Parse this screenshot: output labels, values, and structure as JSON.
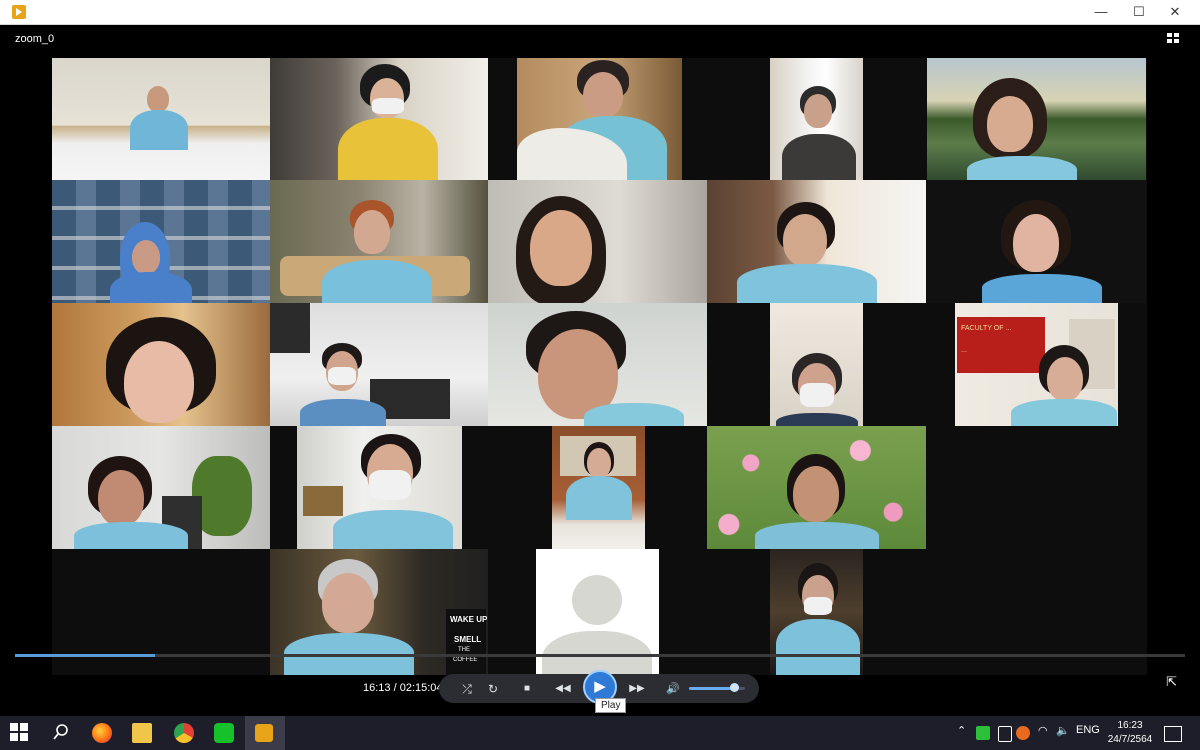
{
  "window": {
    "title": "zoom_0",
    "minimize": "—",
    "maximize": "☐",
    "close": "✕"
  },
  "player": {
    "current_time": "16:13",
    "total_time": "02:15:04",
    "time_separator": " / ",
    "progress": 0.12,
    "volume": 0.8,
    "tooltip": "Play"
  },
  "controls": {
    "shuffle": "⤮",
    "repeat": "↻",
    "stop": "■",
    "prev": "◀◀",
    "play": "▶",
    "next": "▶▶",
    "volume": "🔊"
  },
  "taskbar": {
    "language": "ENG",
    "time": "16:23",
    "date": "24/7/2564"
  },
  "slides": {
    "wake_up": "WAKE UP",
    "smell": "SMELL",
    "the": "THE",
    "coffee": "COFFEE"
  },
  "sign": {
    "line1": "FACULTY OF ...",
    "line2": "..."
  },
  "colors": {
    "accent": "#2e7ad6",
    "taskbar": "#1e1e2a",
    "video_bg": "#0d0d0d"
  }
}
